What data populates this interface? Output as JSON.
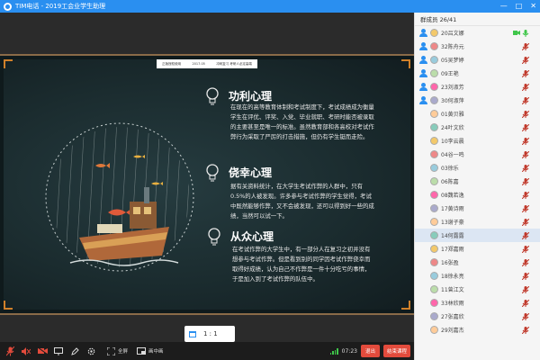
{
  "window": {
    "title": "TIM电话 - 2019工会业学生助理",
    "controls": [
      "minimize-icon",
      "maximize-icon",
      "close-icon"
    ]
  },
  "slide": {
    "header_items": [
      "正版授权使用",
      "2017.05",
      "冲刺复习 考研人必定高端"
    ],
    "sections": [
      {
        "title": "功利心理",
        "body": "在现在的高等教育体制和考试制度下，考试成绩成为衡量学生在评优、评奖、入党、毕业就职、考研时能否被录取的主要甚至是唯一的标准。虽然教育部和各高校对考试作弊行为采取了严厉的打击措施，但仍有学生铤而走险。"
      },
      {
        "title": "侥幸心理",
        "body": "据有关资料统计，在大学生考试作弊的人群中，只有0.5%的人被发现。许多参与考试作弊的学生觉得，考试中既然能够作弊，又不会被发现，还可以得到好一些的成绩，当然可以试一下。"
      },
      {
        "title": "从众心理",
        "body": "在考试作弊的大学生中，有一部分人在复习之初并没有想参与考试作弊。但是看到别的同学因考试作弊侥幸而取得好成绩，认为自己不作弊是一件十分吃亏的事情，于是加入到了考试作弊的队伍中。"
      }
    ],
    "ratio_label": "1 : 1"
  },
  "toolbar": {
    "items": [
      {
        "icon": "microphone-muted-icon",
        "label": ""
      },
      {
        "icon": "speaker-muted-icon",
        "label": ""
      },
      {
        "icon": "camera-muted-icon",
        "label": ""
      },
      {
        "icon": "whiteboard-icon",
        "label": ""
      },
      {
        "icon": "pen-icon",
        "label": ""
      },
      {
        "icon": "settings-icon",
        "label": ""
      },
      {
        "icon": "fullscreen-icon",
        "label": "全屏"
      },
      {
        "icon": "screen-share-icon",
        "label": "画中画"
      }
    ],
    "time": "07:23",
    "exit_label": "退出",
    "end_label": "结束课程"
  },
  "members": {
    "header": "群成员 26/41",
    "list": [
      {
        "name": "20吕文娜",
        "role": "teacher",
        "selected": false
      },
      {
        "name": "32陈舟元",
        "role": "teacher",
        "selected": false
      },
      {
        "name": "05吴梦婷",
        "role": "teacher",
        "selected": false
      },
      {
        "name": "09王艳",
        "role": "teacher",
        "selected": false
      },
      {
        "name": "23刘淑芳",
        "role": "teacher",
        "selected": false
      },
      {
        "name": "30何淑萍",
        "role": "teacher",
        "selected": false
      },
      {
        "name": "01黄贝雅",
        "role": "",
        "selected": false
      },
      {
        "name": "24叶文欣",
        "role": "",
        "selected": false
      },
      {
        "name": "10李云晨",
        "role": "",
        "selected": false
      },
      {
        "name": "04谷一鸣",
        "role": "",
        "selected": false
      },
      {
        "name": "03徐乐",
        "role": "",
        "selected": false
      },
      {
        "name": "06陈嘉",
        "role": "",
        "selected": false
      },
      {
        "name": "08魏若逸",
        "role": "",
        "selected": false
      },
      {
        "name": "17黄诗雨",
        "role": "",
        "selected": false
      },
      {
        "name": "13谢子豪",
        "role": "",
        "selected": false
      },
      {
        "name": "14何露露",
        "role": "",
        "selected": true
      },
      {
        "name": "17郑嘉雨",
        "role": "",
        "selected": false
      },
      {
        "name": "16张盈",
        "role": "",
        "selected": false
      },
      {
        "name": "18徐永亮",
        "role": "",
        "selected": false
      },
      {
        "name": "11曾江文",
        "role": "",
        "selected": false
      },
      {
        "name": "33林欣雨",
        "role": "",
        "selected": false
      },
      {
        "name": "27张嘉欣",
        "role": "",
        "selected": false
      },
      {
        "name": "29刘嘉杰",
        "role": "",
        "selected": false
      }
    ]
  },
  "colors": {
    "accent": "#2a8ff0",
    "danger": "#e34b3c",
    "mic_muted": "#c0392b",
    "active_green": "#3fc64a"
  }
}
